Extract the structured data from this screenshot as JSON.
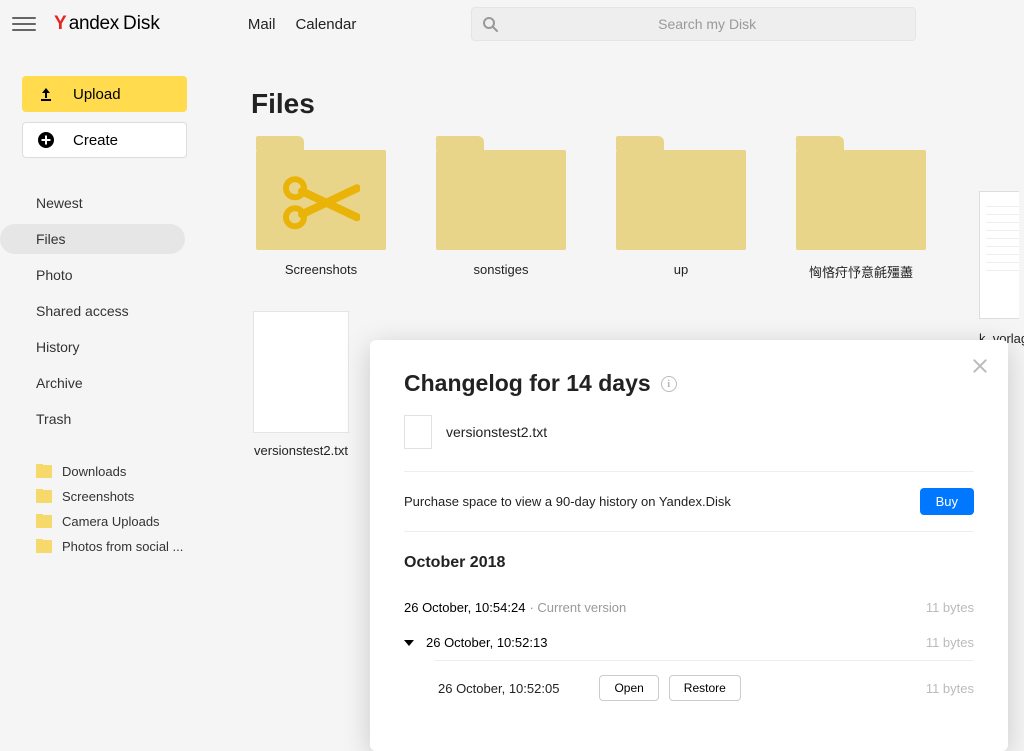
{
  "header": {
    "brand_y": "Y",
    "brand_rest": "andex",
    "brand_product": "Disk",
    "links": [
      "Mail",
      "Calendar"
    ],
    "search_placeholder": "Search my Disk"
  },
  "sidebar": {
    "upload_label": "Upload",
    "create_label": "Create",
    "nav": [
      {
        "label": "Newest",
        "active": false
      },
      {
        "label": "Files",
        "active": true
      },
      {
        "label": "Photo",
        "active": false
      },
      {
        "label": "Shared access",
        "active": false
      },
      {
        "label": "History",
        "active": false
      },
      {
        "label": "Archive",
        "active": false
      },
      {
        "label": "Trash",
        "active": false
      }
    ],
    "quick_folders": [
      "Downloads",
      "Screenshots",
      "Camera Uploads",
      "Photos from social ..."
    ]
  },
  "main": {
    "title": "Files",
    "folders": [
      {
        "label": "Screenshots",
        "scissors": true
      },
      {
        "label": "sonstiges",
        "scissors": false
      },
      {
        "label": "up",
        "scissors": false
      },
      {
        "label": "恟悋疛忬意毹殭藎",
        "scissors": false
      }
    ],
    "edge_item_label": "k_vorlag",
    "file_tile_label": "versionstest2.txt"
  },
  "modal": {
    "title": "Changelog for 14 days",
    "file_name": "versionstest2.txt",
    "purchase_text": "Purchase space to view a 90-day history on Yandex.Disk",
    "buy_label": "Buy",
    "month_heading": "October 2018",
    "versions": {
      "current": {
        "ts": "26 October, 10:54:24",
        "note": "· Current version",
        "size": "11 bytes"
      },
      "group": {
        "ts": "26 October, 10:52:13",
        "size": "11 bytes"
      },
      "sub": {
        "ts": "26 October, 10:52:05",
        "size": "11 bytes",
        "open": "Open",
        "restore": "Restore"
      }
    }
  }
}
